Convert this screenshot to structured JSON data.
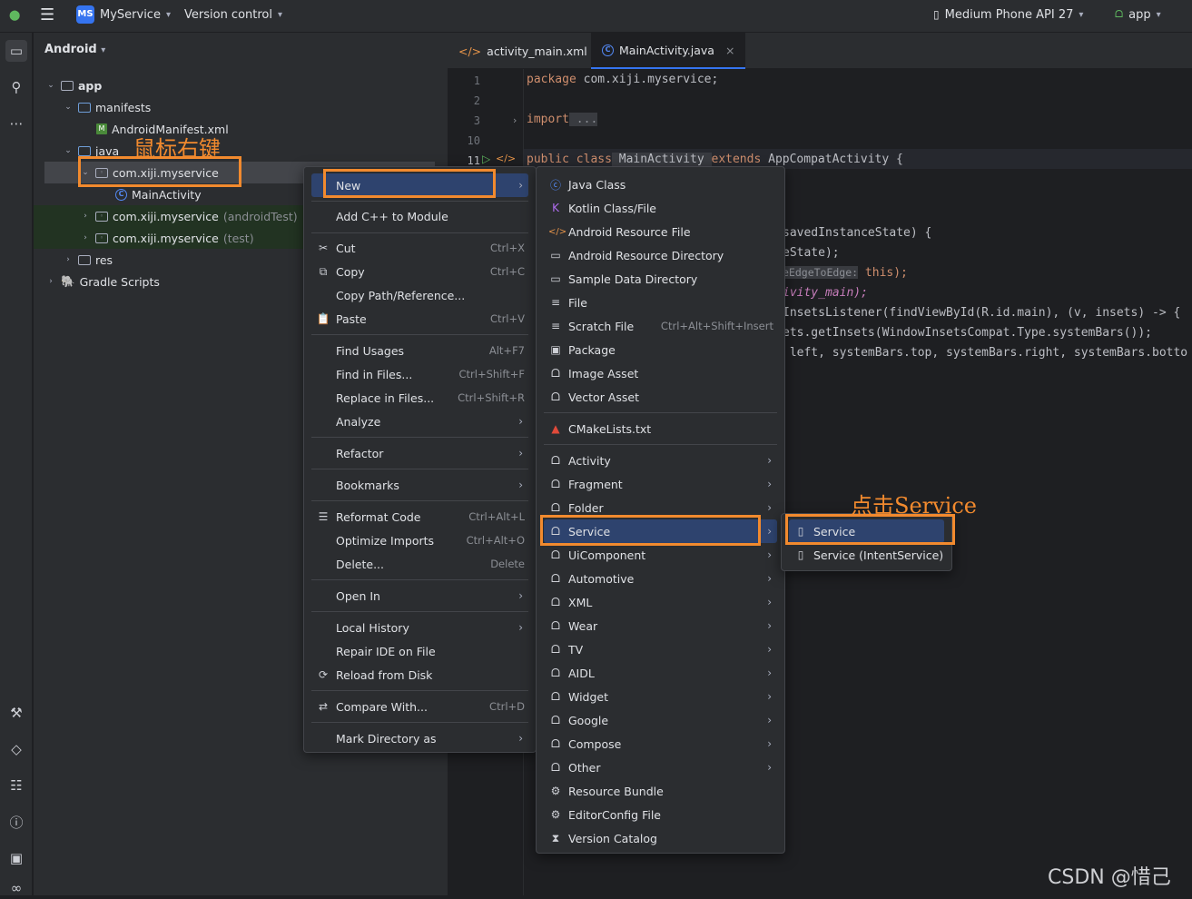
{
  "titlebar": {
    "project_badge": "MS",
    "project_name": "MyService",
    "vcs": "Version control",
    "device": "Medium Phone API 27",
    "run_config": "app"
  },
  "project_panel": {
    "view": "Android",
    "tree": [
      {
        "label": "app"
      },
      {
        "label": "manifests"
      },
      {
        "label": "AndroidManifest.xml"
      },
      {
        "label": "java"
      },
      {
        "label": "com.xiji.myservice"
      },
      {
        "label": "MainActivity"
      },
      {
        "label": "com.xiji.myservice",
        "suffix": "(androidTest)"
      },
      {
        "label": "com.xiji.myservice",
        "suffix": "(test)"
      },
      {
        "label": "res"
      },
      {
        "label": "Gradle Scripts"
      }
    ]
  },
  "editor": {
    "tabs": [
      {
        "label": "activity_main.xml"
      },
      {
        "label": "MainActivity.java"
      }
    ],
    "line_numbers": [
      "1",
      "2",
      "3",
      "10",
      "11"
    ],
    "lines": {
      "l1_kw": "package",
      "l1_rest": " com.xiji.myservice;",
      "l3_kw": "import",
      "l3_rest": " ...",
      "l11_a": "public class",
      "l11_b": " MainActivity ",
      "l11_c": "extends",
      "l11_d": " AppCompatActivity {",
      "f1": "savedInstanceState) {",
      "f2": "eState);",
      "f3_hint": "eEdgeToEdge:",
      "f3_rest": " this);",
      "f4": "ivity_main);",
      "f5": "InsetsListener(findViewById(R.id.main), (v, insets) -> {",
      "f6": "ets.getInsets(WindowInsetsCompat.Type.systemBars());",
      "f7": " left, systemBars.top, systemBars.right, systemBars.botto"
    }
  },
  "context_menu": {
    "items": [
      {
        "label": "New",
        "arrow": true
      },
      {
        "label": "Add C++ to Module"
      },
      {
        "label": "Cut",
        "shortcut": "Ctrl+X",
        "icon": "scissors-icon"
      },
      {
        "label": "Copy",
        "shortcut": "Ctrl+C",
        "icon": "copy-icon"
      },
      {
        "label": "Copy Path/Reference..."
      },
      {
        "label": "Paste",
        "shortcut": "Ctrl+V",
        "icon": "paste-icon"
      },
      {
        "label": "Find Usages",
        "shortcut": "Alt+F7"
      },
      {
        "label": "Find in Files...",
        "shortcut": "Ctrl+Shift+F"
      },
      {
        "label": "Replace in Files...",
        "shortcut": "Ctrl+Shift+R"
      },
      {
        "label": "Analyze",
        "arrow": true
      },
      {
        "label": "Refactor",
        "arrow": true
      },
      {
        "label": "Bookmarks",
        "arrow": true
      },
      {
        "label": "Reformat Code",
        "shortcut": "Ctrl+Alt+L",
        "icon": "reformat-icon"
      },
      {
        "label": "Optimize Imports",
        "shortcut": "Ctrl+Alt+O"
      },
      {
        "label": "Delete...",
        "shortcut": "Delete"
      },
      {
        "label": "Open In",
        "arrow": true
      },
      {
        "label": "Local History",
        "arrow": true
      },
      {
        "label": "Repair IDE on File"
      },
      {
        "label": "Reload from Disk",
        "icon": "reload-icon"
      },
      {
        "label": "Compare With...",
        "shortcut": "Ctrl+D",
        "icon": "compare-icon"
      },
      {
        "label": "Mark Directory as",
        "arrow": true
      }
    ]
  },
  "new_submenu": {
    "items": [
      {
        "label": "Java Class"
      },
      {
        "label": "Kotlin Class/File"
      },
      {
        "label": "Android Resource File"
      },
      {
        "label": "Android Resource Directory"
      },
      {
        "label": "Sample Data Directory"
      },
      {
        "label": "File"
      },
      {
        "label": "Scratch File",
        "shortcut": "Ctrl+Alt+Shift+Insert"
      },
      {
        "label": "Package"
      },
      {
        "label": "Image Asset"
      },
      {
        "label": "Vector Asset"
      },
      {
        "label": "CMakeLists.txt"
      },
      {
        "label": "Activity"
      },
      {
        "label": "Fragment"
      },
      {
        "label": "Folder"
      },
      {
        "label": "Service"
      },
      {
        "label": "UiComponent"
      },
      {
        "label": "Automotive"
      },
      {
        "label": "XML"
      },
      {
        "label": "Wear"
      },
      {
        "label": "TV"
      },
      {
        "label": "AIDL"
      },
      {
        "label": "Widget"
      },
      {
        "label": "Google"
      },
      {
        "label": "Compose"
      },
      {
        "label": "Other"
      },
      {
        "label": "Resource Bundle"
      },
      {
        "label": "EditorConfig File"
      },
      {
        "label": "Version Catalog"
      }
    ]
  },
  "service_submenu": {
    "items": [
      {
        "label": "Service"
      },
      {
        "label": "Service (IntentService)"
      }
    ]
  },
  "annotations": {
    "right_click": "鼠标右键",
    "click_service": "点击Service"
  },
  "watermark": "CSDN @惜己",
  "colors": {
    "accent": "#3574f0",
    "highlight": "#f28a2e",
    "selection": "#2e436e",
    "android_green": "#5fb85f"
  }
}
